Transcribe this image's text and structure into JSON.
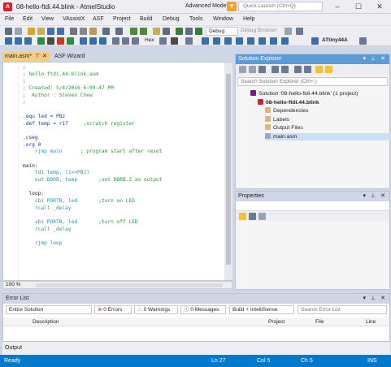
{
  "window": {
    "title": "08-hello-ftdi.44.blink - AtmelStudio",
    "mode_label": "Advanced Mode",
    "quick_launch_placeholder": "Quick Launch (Ctrl+Q)",
    "app_icon_glyph": "A"
  },
  "menu": [
    "File",
    "Edit",
    "View",
    "VAssistX",
    "ASF",
    "Project",
    "Build",
    "Debug",
    "Tools",
    "Window",
    "Help"
  ],
  "toolbar": {
    "config": "Debug",
    "debug_browser": "Debug Browser",
    "hex_label": "Hex",
    "device": "ATtiny44A"
  },
  "tabs": [
    {
      "label": "main.asm*",
      "close": "✕",
      "pin": "⊤"
    },
    {
      "label": "ASF Wizard"
    }
  ],
  "editor": {
    "zoom": "100 %",
    "lines": [
      {
        "text": ";",
        "kind": "comment"
      },
      {
        "text": "; hello.ftdi.44.blink.asm",
        "kind": "comment"
      },
      {
        "text": ";",
        "kind": "comment"
      },
      {
        "text": "; Created: 5/4/2016 6:09:47 PM",
        "kind": "comment"
      },
      {
        "text": ";  Author : Steven Chew",
        "kind": "comment"
      },
      {
        "text": ";",
        "kind": "comment"
      },
      {
        "text": "",
        "kind": "plain"
      },
      {
        "text": ".equ led = PB2",
        "kind": "directive"
      },
      {
        "text": ".def temp = r17     ;scratch register",
        "kind": "directive"
      },
      {
        "text": "",
        "kind": "plain"
      },
      {
        "text": ".cseg",
        "kind": "directive"
      },
      {
        "text": ".org 0",
        "kind": "directive"
      },
      {
        "text": "    rjmp main      ; program start after reset",
        "kind": "code"
      },
      {
        "text": "",
        "kind": "plain"
      },
      {
        "text": "main:",
        "kind": "plain"
      },
      {
        "text": "    ldi temp, (1<<PB2)",
        "kind": "code"
      },
      {
        "text": "    out DDRB, temp       ;set DDRB.2 as output",
        "kind": "code"
      },
      {
        "text": "",
        "kind": "plain"
      },
      {
        "text": "  loop:",
        "kind": "plain"
      },
      {
        "text": "    cbi PORTB, led       ;turn on LED",
        "kind": "code"
      },
      {
        "text": "    rcall _delay",
        "kind": "code"
      },
      {
        "text": "",
        "kind": "plain"
      },
      {
        "text": "    sbi PORTB, led       ;turn off LED",
        "kind": "code"
      },
      {
        "text": "    rcall _delay",
        "kind": "code"
      },
      {
        "text": "",
        "kind": "plain"
      },
      {
        "text": "    rjmp loop",
        "kind": "code"
      },
      {
        "text": "",
        "kind": "plain"
      }
    ]
  },
  "solution_explorer": {
    "title": "Solution Explorer",
    "search_placeholder": "Search Solution Explorer (Ctrl+;)",
    "items": [
      {
        "label": "Solution '08-hello-ftdi.44.blink' (1 project)",
        "level": 0,
        "bold": false,
        "color": "#68217a"
      },
      {
        "label": "08-hello-ftdi.44.blink",
        "level": 1,
        "bold": true,
        "color": "#d2222d"
      },
      {
        "label": "Dependencies",
        "level": 2,
        "bold": false,
        "color": "#dcb67a"
      },
      {
        "label": "Labels",
        "level": 2,
        "bold": false,
        "color": "#dcb67a"
      },
      {
        "label": "Output Files",
        "level": 2,
        "bold": false,
        "color": "#dcb67a"
      },
      {
        "label": "main.asm",
        "level": 2,
        "bold": false,
        "color": "#9aa9c0",
        "selected": true
      }
    ]
  },
  "properties": {
    "title": "Properties"
  },
  "error_list": {
    "title": "Error List",
    "scope": "Entire Solution",
    "errors": "0 Errors",
    "warnings": "0 Warnings",
    "messages": "0 Messages",
    "build_filter": "Build + IntelliSense",
    "search_placeholder": "Search Error List",
    "columns": [
      "Description",
      "Project",
      "File",
      "Line"
    ]
  },
  "output": {
    "title": "Output"
  },
  "status": {
    "ready": "Ready",
    "line": "Ln 27",
    "col": "Col 5",
    "ch": "Ch 5",
    "mode": "INS"
  }
}
